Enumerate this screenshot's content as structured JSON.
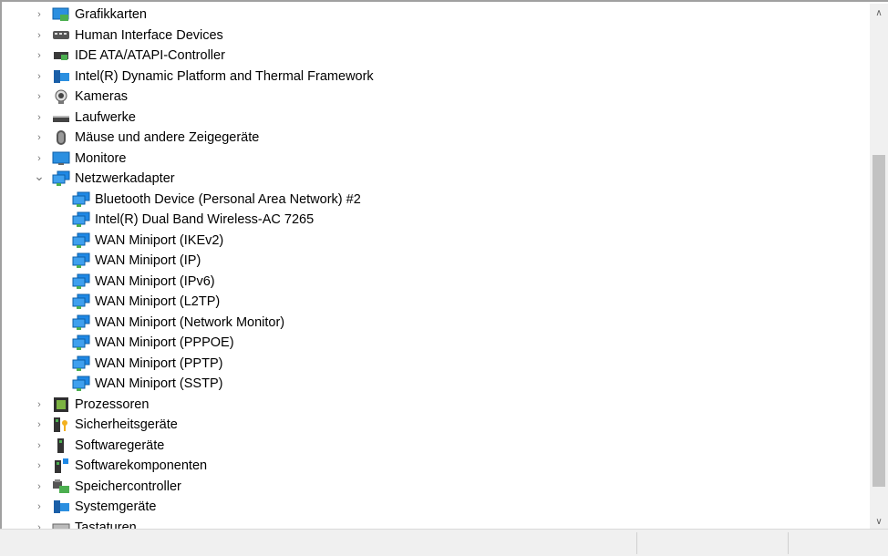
{
  "tree": {
    "items": [
      {
        "label": "Grafikkarten",
        "icon": "display-adapter-icon",
        "level": 0,
        "expanded": false
      },
      {
        "label": "Human Interface Devices",
        "icon": "hid-icon",
        "level": 0,
        "expanded": false
      },
      {
        "label": "IDE ATA/ATAPI-Controller",
        "icon": "ide-controller-icon",
        "level": 0,
        "expanded": false
      },
      {
        "label": "Intel(R) Dynamic Platform and Thermal Framework",
        "icon": "system-device-icon",
        "level": 0,
        "expanded": false
      },
      {
        "label": "Kameras",
        "icon": "camera-icon",
        "level": 0,
        "expanded": false
      },
      {
        "label": "Laufwerke",
        "icon": "disk-drive-icon",
        "level": 0,
        "expanded": false
      },
      {
        "label": "Mäuse und andere Zeigegeräte",
        "icon": "mouse-icon",
        "level": 0,
        "expanded": false
      },
      {
        "label": "Monitore",
        "icon": "monitor-icon",
        "level": 0,
        "expanded": false
      },
      {
        "label": "Netzwerkadapter",
        "icon": "network-adapter-icon",
        "level": 0,
        "expanded": true
      },
      {
        "label": "Bluetooth Device (Personal Area Network) #2",
        "icon": "network-adapter-icon",
        "level": 1
      },
      {
        "label": "Intel(R) Dual Band Wireless-AC 7265",
        "icon": "network-adapter-icon",
        "level": 1
      },
      {
        "label": "WAN Miniport (IKEv2)",
        "icon": "network-adapter-icon",
        "level": 1
      },
      {
        "label": "WAN Miniport (IP)",
        "icon": "network-adapter-icon",
        "level": 1
      },
      {
        "label": "WAN Miniport (IPv6)",
        "icon": "network-adapter-icon",
        "level": 1
      },
      {
        "label": "WAN Miniport (L2TP)",
        "icon": "network-adapter-icon",
        "level": 1
      },
      {
        "label": "WAN Miniport (Network Monitor)",
        "icon": "network-adapter-icon",
        "level": 1
      },
      {
        "label": "WAN Miniport (PPPOE)",
        "icon": "network-adapter-icon",
        "level": 1
      },
      {
        "label": "WAN Miniport (PPTP)",
        "icon": "network-adapter-icon",
        "level": 1
      },
      {
        "label": "WAN Miniport (SSTP)",
        "icon": "network-adapter-icon",
        "level": 1
      },
      {
        "label": "Prozessoren",
        "icon": "processor-icon",
        "level": 0,
        "expanded": false
      },
      {
        "label": "Sicherheitsgeräte",
        "icon": "security-device-icon",
        "level": 0,
        "expanded": false
      },
      {
        "label": "Softwaregeräte",
        "icon": "software-device-icon",
        "level": 0,
        "expanded": false
      },
      {
        "label": "Softwarekomponenten",
        "icon": "software-component-icon",
        "level": 0,
        "expanded": false
      },
      {
        "label": "Speichercontroller",
        "icon": "storage-controller-icon",
        "level": 0,
        "expanded": false
      },
      {
        "label": "Systemgeräte",
        "icon": "system-device-icon",
        "level": 0,
        "expanded": false
      },
      {
        "label": "Tastaturen",
        "icon": "keyboard-icon",
        "level": 0,
        "expanded": false
      }
    ]
  },
  "colors": {
    "border": "#a0a0a0",
    "scrollbar_track": "#f0f0f0",
    "scrollbar_thumb": "#c2c2c2",
    "status_bar": "#f0f0f0",
    "network_blue": "#1e88e5",
    "network_green": "#4caf50"
  }
}
